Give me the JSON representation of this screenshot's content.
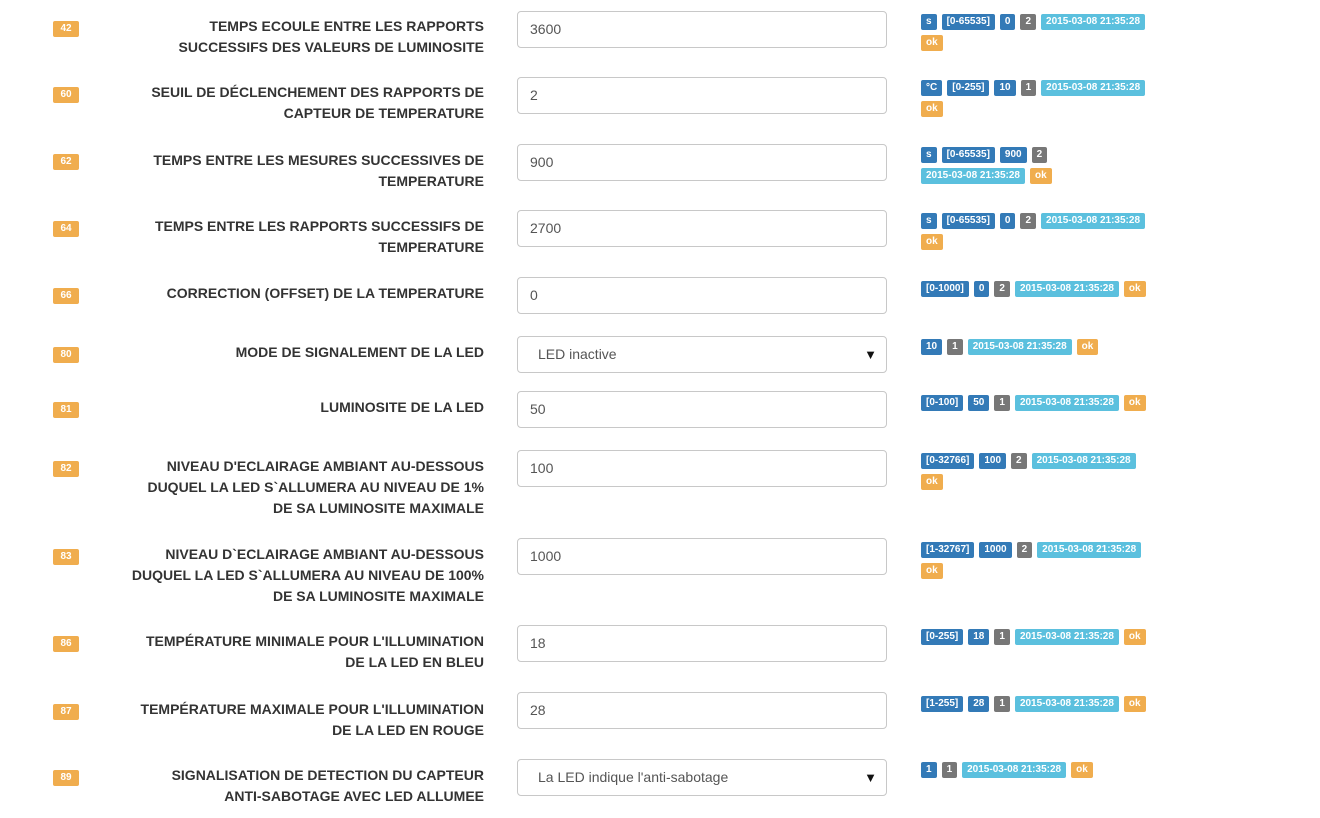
{
  "params": [
    {
      "num": "42",
      "label_lines": [
        "TEMPS ECOULE ENTRE LES RAPPORTS",
        "SUCCESSIFS DES VALEURS DE LUMINOSITE"
      ],
      "control": "input",
      "value": "3600",
      "badges": [
        {
          "t": "s",
          "c": "blue"
        },
        {
          "t": "[0-65535]",
          "c": "blue"
        },
        {
          "t": "0",
          "c": "blue"
        },
        {
          "t": "2",
          "c": "gray"
        },
        {
          "t": "2015-03-08 21:35:28",
          "c": "cyan"
        },
        {
          "t": "ok",
          "c": "orange"
        }
      ]
    },
    {
      "num": "60",
      "label_lines": [
        "SEUIL DE DÉCLENCHEMENT DES RAPPORTS DE",
        "CAPTEUR DE TEMPERATURE"
      ],
      "control": "input",
      "value": "2",
      "badges": [
        {
          "t": "°C",
          "c": "blue"
        },
        {
          "t": "[0-255]",
          "c": "blue"
        },
        {
          "t": "10",
          "c": "blue"
        },
        {
          "t": "1",
          "c": "gray"
        },
        {
          "t": "2015-03-08 21:35:28",
          "c": "cyan"
        },
        {
          "t": "ok",
          "c": "orange"
        }
      ]
    },
    {
      "num": "62",
      "label_lines": [
        "TEMPS ENTRE LES MESURES SUCCESSIVES DE",
        "TEMPERATURE"
      ],
      "control": "input",
      "value": "900",
      "badges": [
        {
          "t": "s",
          "c": "blue"
        },
        {
          "t": "[0-65535]",
          "c": "blue"
        },
        {
          "t": "900",
          "c": "blue"
        },
        {
          "t": "2",
          "c": "gray"
        },
        {
          "t": "2015-03-08 21:35:28",
          "c": "cyan"
        },
        {
          "t": "ok",
          "c": "orange"
        }
      ]
    },
    {
      "num": "64",
      "label_lines": [
        "TEMPS ENTRE LES RAPPORTS SUCCESSIFS DE",
        "TEMPERATURE"
      ],
      "control": "input",
      "value": "2700",
      "badges": [
        {
          "t": "s",
          "c": "blue"
        },
        {
          "t": "[0-65535]",
          "c": "blue"
        },
        {
          "t": "0",
          "c": "blue"
        },
        {
          "t": "2",
          "c": "gray"
        },
        {
          "t": "2015-03-08 21:35:28",
          "c": "cyan"
        },
        {
          "t": "ok",
          "c": "orange"
        }
      ]
    },
    {
      "num": "66",
      "label_lines": [
        "CORRECTION (OFFSET) DE LA TEMPERATURE"
      ],
      "control": "input",
      "value": "0",
      "badges": [
        {
          "t": "[0-1000]",
          "c": "blue"
        },
        {
          "t": "0",
          "c": "blue"
        },
        {
          "t": "2",
          "c": "gray"
        },
        {
          "t": "2015-03-08 21:35:28",
          "c": "cyan"
        },
        {
          "t": "ok",
          "c": "orange"
        }
      ]
    },
    {
      "num": "80",
      "label_lines": [
        "MODE DE SIGNALEMENT DE LA LED"
      ],
      "control": "select",
      "value": "LED inactive",
      "badges": [
        {
          "t": "10",
          "c": "blue"
        },
        {
          "t": "1",
          "c": "gray"
        },
        {
          "t": "2015-03-08 21:35:28",
          "c": "cyan"
        },
        {
          "t": "ok",
          "c": "orange"
        }
      ]
    },
    {
      "num": "81",
      "label_lines": [
        "LUMINOSITE DE LA LED"
      ],
      "control": "input",
      "value": "50",
      "badges": [
        {
          "t": "[0-100]",
          "c": "blue"
        },
        {
          "t": "50",
          "c": "blue"
        },
        {
          "t": "1",
          "c": "gray"
        },
        {
          "t": "2015-03-08 21:35:28",
          "c": "cyan"
        },
        {
          "t": "ok",
          "c": "orange"
        }
      ]
    },
    {
      "num": "82",
      "label_lines": [
        "NIVEAU D'ECLAIRAGE AMBIANT AU-DESSOUS",
        "DUQUEL LA LED S`ALLUMERA AU NIVEAU DE 1%",
        "DE SA LUMINOSITE MAXIMALE"
      ],
      "control": "input",
      "value": "100",
      "badges": [
        {
          "t": "[0-32766]",
          "c": "blue"
        },
        {
          "t": "100",
          "c": "blue"
        },
        {
          "t": "2",
          "c": "gray"
        },
        {
          "t": "2015-03-08 21:35:28",
          "c": "cyan"
        },
        {
          "t": "ok",
          "c": "orange"
        }
      ]
    },
    {
      "num": "83",
      "label_lines": [
        "NIVEAU D`ECLAIRAGE AMBIANT AU-DESSOUS",
        "DUQUEL LA LED S`ALLUMERA AU NIVEAU DE 100%",
        "DE SA LUMINOSITE MAXIMALE"
      ],
      "control": "input",
      "value": "1000",
      "badges": [
        {
          "t": "[1-32767]",
          "c": "blue"
        },
        {
          "t": "1000",
          "c": "blue"
        },
        {
          "t": "2",
          "c": "gray"
        },
        {
          "t": "2015-03-08 21:35:28",
          "c": "cyan"
        },
        {
          "t": "ok",
          "c": "orange"
        }
      ]
    },
    {
      "num": "86",
      "label_lines": [
        "TEMPÉRATURE MINIMALE POUR L'ILLUMINATION",
        "DE LA LED EN BLEU"
      ],
      "control": "input",
      "value": "18",
      "badges": [
        {
          "t": "[0-255]",
          "c": "blue"
        },
        {
          "t": "18",
          "c": "blue"
        },
        {
          "t": "1",
          "c": "gray"
        },
        {
          "t": "2015-03-08 21:35:28",
          "c": "cyan"
        },
        {
          "t": "ok",
          "c": "orange"
        }
      ]
    },
    {
      "num": "87",
      "label_lines": [
        "TEMPÉRATURE MAXIMALE POUR L'ILLUMINATION",
        "DE LA LED EN ROUGE"
      ],
      "control": "input",
      "value": "28",
      "badges": [
        {
          "t": "[1-255]",
          "c": "blue"
        },
        {
          "t": "28",
          "c": "blue"
        },
        {
          "t": "1",
          "c": "gray"
        },
        {
          "t": "2015-03-08 21:35:28",
          "c": "cyan"
        },
        {
          "t": "ok",
          "c": "orange"
        }
      ]
    },
    {
      "num": "89",
      "label_lines": [
        "SIGNALISATION DE DETECTION DU CAPTEUR",
        "ANTI-SABOTAGE AVEC LED ALLUMEE"
      ],
      "control": "select",
      "value": "La LED indique l'anti-sabotage",
      "badges": [
        {
          "t": "1",
          "c": "blue"
        },
        {
          "t": "1",
          "c": "gray"
        },
        {
          "t": "2015-03-08 21:35:28",
          "c": "cyan"
        },
        {
          "t": "ok",
          "c": "orange"
        }
      ]
    }
  ],
  "colors": {
    "num_badge": "#f0ad4e",
    "blue": "#337ab7",
    "gray": "#777777",
    "cyan": "#5bc0de",
    "orange": "#f0ad4e"
  },
  "icons": {
    "select_arrow": "caret-down-icon"
  }
}
